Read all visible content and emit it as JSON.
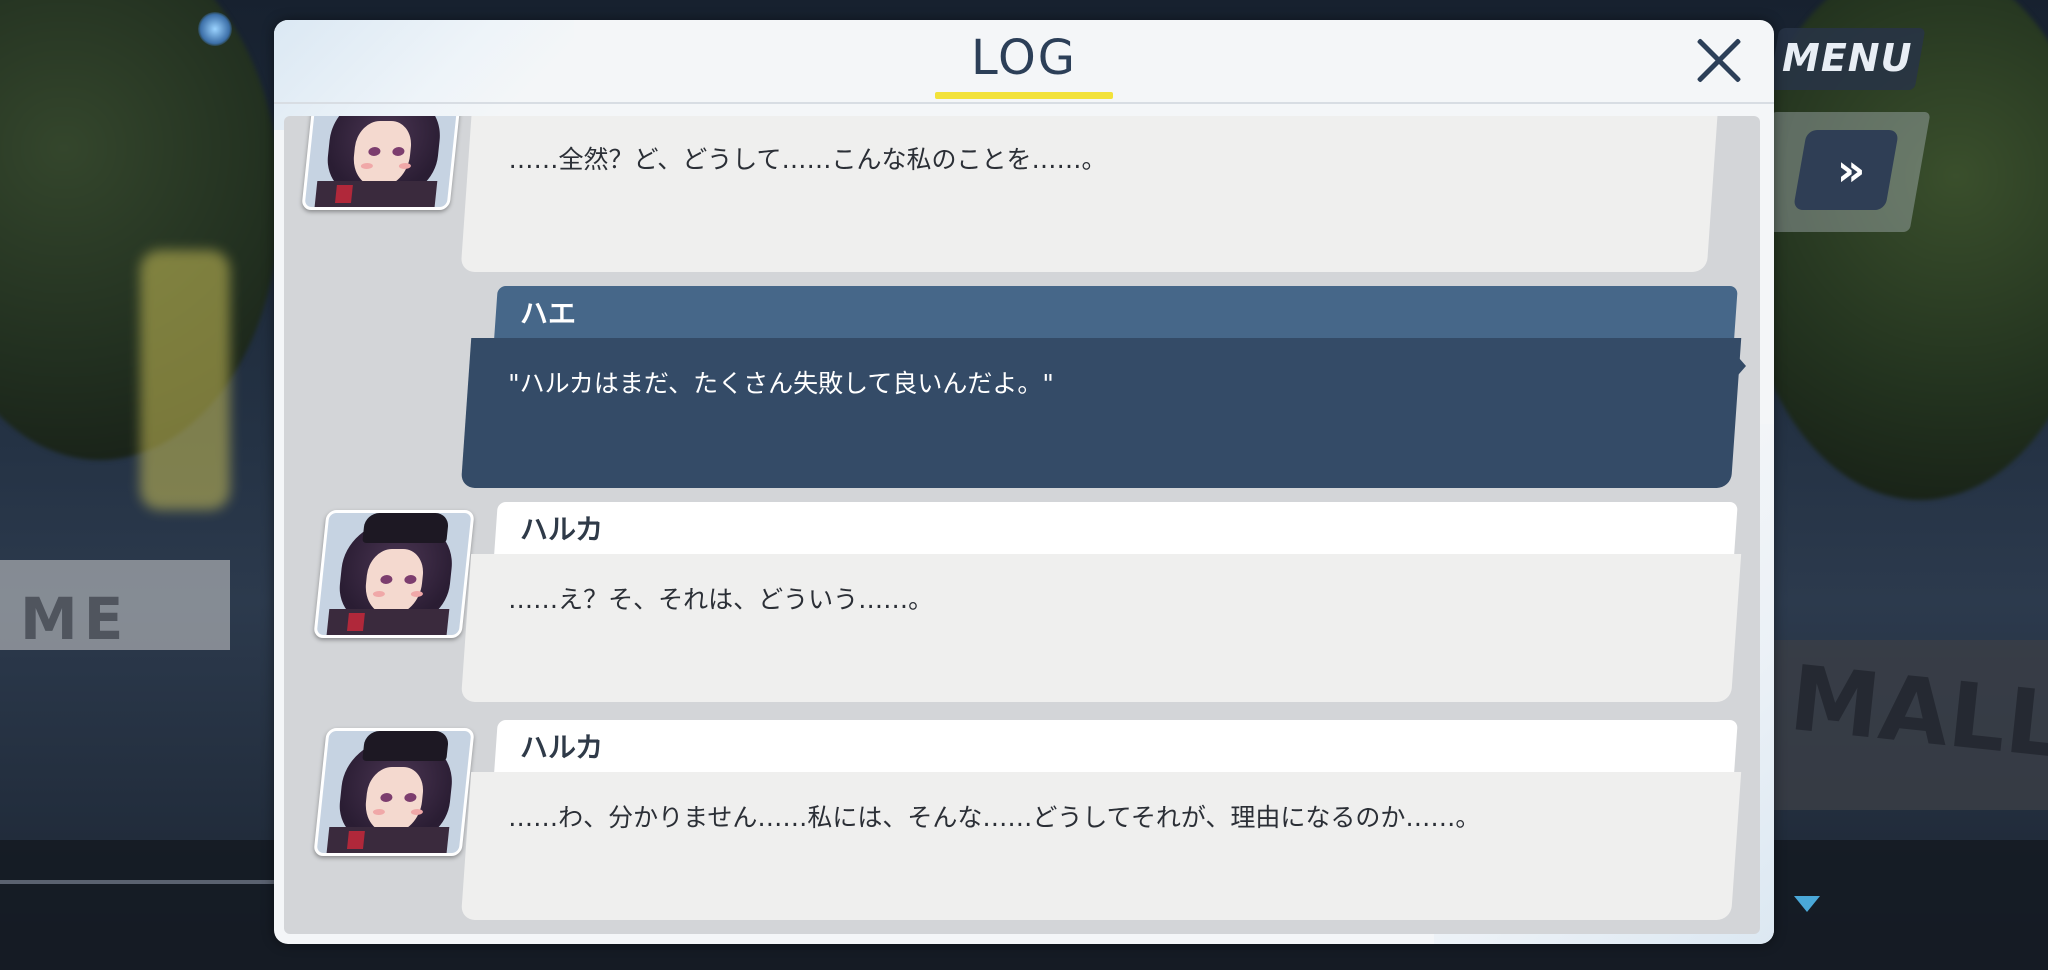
{
  "hud": {
    "menu_label": "MENU",
    "fast_forward_label": "»"
  },
  "background": {
    "sign_text": "ME",
    "mall_text": "MALL"
  },
  "log": {
    "title": "LOG",
    "entries": [
      {
        "speaker": "",
        "text": "……全然？ど、どうして……こんな私のことを……。",
        "role": "npc"
      },
      {
        "speaker": "ハエ",
        "text": "\"ハルカはまだ、たくさん失敗して良いんだよ。\"",
        "role": "player"
      },
      {
        "speaker": "ハルカ",
        "text": "……え？そ、それは、どういう……。",
        "role": "npc"
      },
      {
        "speaker": "ハルカ",
        "text": "……わ、分かりません……私には、そんな……どうしてそれが、理由になるのか……。",
        "role": "npc"
      }
    ]
  },
  "colors": {
    "title": "#2c3f58",
    "title_underline": "#f2e23a",
    "player_name_bar": "#466789",
    "player_bubble": "#344b67",
    "npc_bubble": "#efefee"
  },
  "icons": {
    "close": "close-icon",
    "fast_forward": "fast-forward-icon",
    "scroll_down": "scroll-down-indicator-icon"
  }
}
